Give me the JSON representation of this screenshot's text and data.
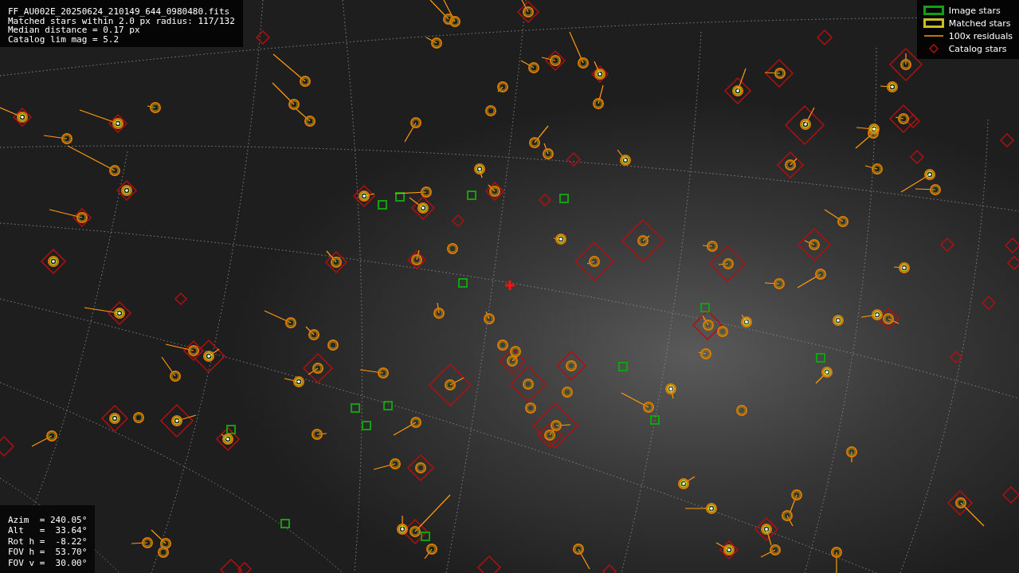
{
  "header": {
    "lines": [
      "FF_AU002E_20250624_210149_644_0980480.fits",
      "Matched stars within 2.0 px radius: 117/132",
      "Median distance = 0.17 px",
      "Catalog lim mag = 5.2"
    ]
  },
  "legend": {
    "items": [
      {
        "kind": "image",
        "label": "Image stars"
      },
      {
        "kind": "matched",
        "label": "Matched stars"
      },
      {
        "kind": "residual",
        "label": "100x residuals"
      },
      {
        "kind": "catalog",
        "label": "Catalog stars"
      }
    ]
  },
  "pointing": {
    "lines": [
      "Azim  = 240.05°",
      "Alt   =  33.64°",
      "Rot h =  -8.22°",
      "FOV h =  53.70°",
      "FOV v =  30.00°"
    ]
  }
}
